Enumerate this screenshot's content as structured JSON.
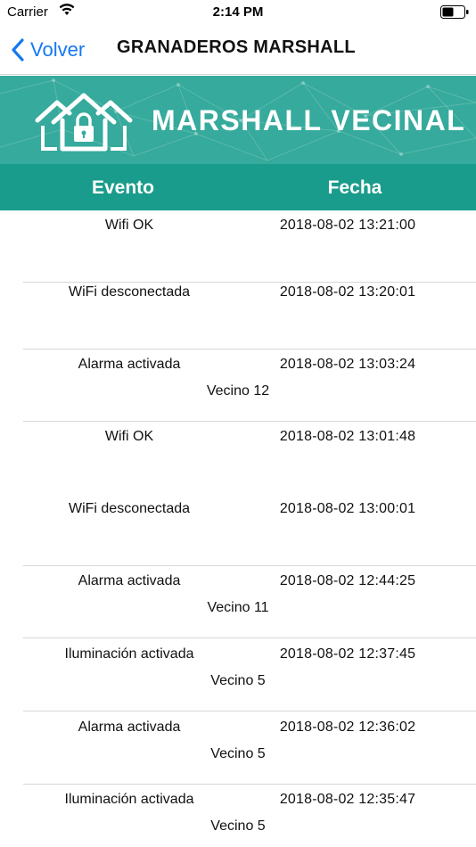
{
  "status_bar": {
    "carrier": "Carrier",
    "time": "2:14 PM"
  },
  "nav": {
    "back_label": "Volver",
    "title": "GRANADEROS MARSHALL"
  },
  "banner": {
    "title": "MARSHALL VECINAL",
    "color": "#36aa9c"
  },
  "table": {
    "headers": {
      "evento": "Evento",
      "fecha": "Fecha"
    },
    "rows": [
      {
        "evento": "Wifi OK",
        "fecha": "2018-08-02 13:21:00",
        "vecino": ""
      },
      {
        "evento": "WiFi desconectada",
        "fecha": "2018-08-02 13:20:01",
        "vecino": ""
      },
      {
        "evento": "Alarma activada",
        "fecha": "2018-08-02 13:03:24",
        "vecino": "Vecino 12"
      },
      {
        "evento": "Wifi OK",
        "fecha": "2018-08-02 13:01:48",
        "vecino": ""
      },
      {
        "evento": "WiFi desconectada",
        "fecha": "2018-08-02 13:00:01",
        "vecino": ""
      },
      {
        "evento": "Alarma activada",
        "fecha": "2018-08-02 12:44:25",
        "vecino": "Vecino 11"
      },
      {
        "evento": "Iluminación activada",
        "fecha": "2018-08-02 12:37:45",
        "vecino": "Vecino 5"
      },
      {
        "evento": "Alarma activada",
        "fecha": "2018-08-02 12:36:02",
        "vecino": "Vecino 5"
      },
      {
        "evento": "Iluminación activada",
        "fecha": "2018-08-02 12:35:47",
        "vecino": "Vecino 5"
      }
    ]
  },
  "colors": {
    "accent": "#1578f5",
    "header_teal": "#1a9c8c"
  }
}
